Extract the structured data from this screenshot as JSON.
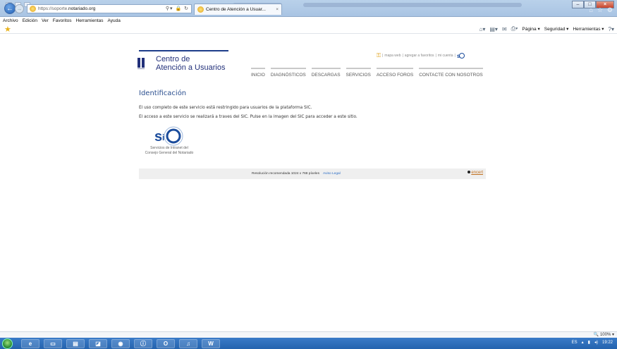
{
  "browser": {
    "url_prefix": "https://",
    "url_host_pre": "soporte.",
    "url_host": "notariado.org",
    "tab_title": "Centro de Atención a Usuar...",
    "tab_close": "×",
    "menu": [
      "Archivo",
      "Edición",
      "Ver",
      "Favoritos",
      "Herramientas",
      "Ayuda"
    ],
    "commands": [
      "Página ▾",
      "Seguridad ▾",
      "Herramientas ▾"
    ],
    "zoom": "100%"
  },
  "header": {
    "title_line1": "Centro de",
    "title_line2": "Atención a Usuarios",
    "links": [
      "mapa web",
      "agregar a favoritos",
      "mi cuenta"
    ],
    "nav": [
      "INICIO",
      "DIAGNÓSTICOS",
      "DESCARGAS",
      "SERVICIOS",
      "ACCESO FOROS",
      "CONTACTE CON NOSOTROS"
    ]
  },
  "main": {
    "heading": "Identificación",
    "para1": "El uso completo de este servicio está restringido para usuarios de la plataforma SIC.",
    "para2": "El acceso a este servicio se realizará a traves del SIC. Pulse en la imagen del SIC para acceder a este sitio.",
    "sic_text": "sic",
    "sic_caption_1": "Servicios de Intranet del",
    "sic_caption_2": "Consejo General del Notariado"
  },
  "footer": {
    "resolution": "Resolución recomendada 1024 x 768 píxeles",
    "legal": "Aviso Legal",
    "encert": "encert"
  },
  "taskbar": {
    "lang": "ES",
    "time": "19:22",
    "word_label": "W"
  },
  "colors": {
    "brand_blue": "#22307a",
    "heading_blue": "#2b4f8f",
    "taskbar": "#2463ae"
  }
}
